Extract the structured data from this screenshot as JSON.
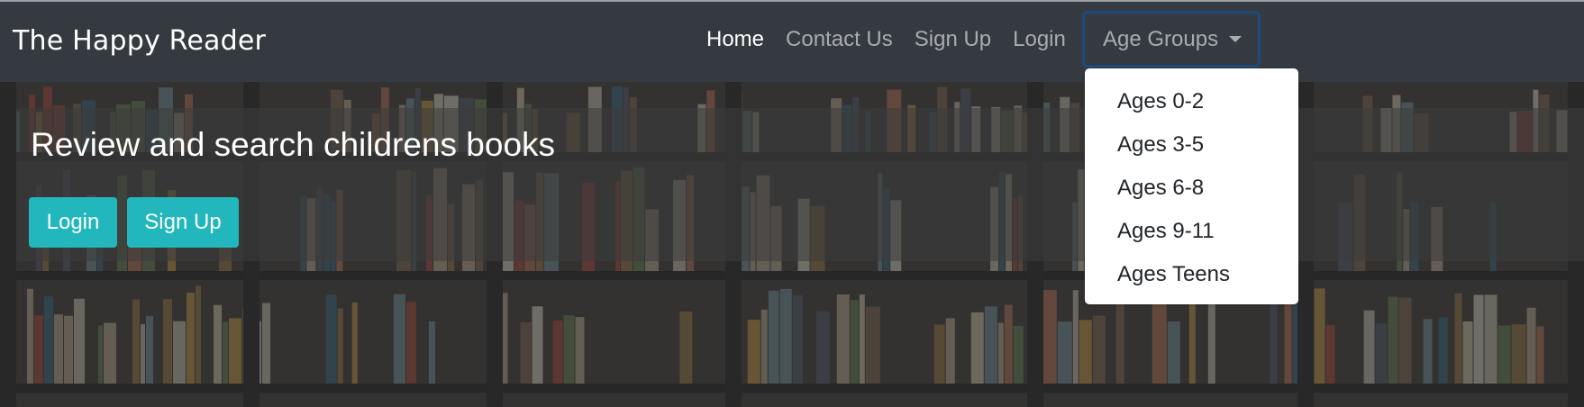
{
  "navbar": {
    "brand": "The Happy Reader",
    "links": [
      {
        "label": "Home",
        "active": true
      },
      {
        "label": "Contact Us",
        "active": false
      },
      {
        "label": "Sign Up",
        "active": false
      },
      {
        "label": "Login",
        "active": false
      }
    ],
    "dropdown_label": "Age Groups",
    "dropdown_icon": "caret-down-icon"
  },
  "dropdown_menu": {
    "items": [
      "Ages 0-2",
      "Ages 3-5",
      "Ages 6-8",
      "Ages 9-11",
      "Ages Teens"
    ]
  },
  "hero": {
    "title": "Review and search childrens books",
    "login_button": "Login",
    "signup_button": "Sign Up"
  },
  "colors": {
    "navbar_bg": "#343a40",
    "button_accent": "#22b7bd",
    "nav_active": "#ffffff",
    "nav_inactive": "#a8acb0"
  }
}
